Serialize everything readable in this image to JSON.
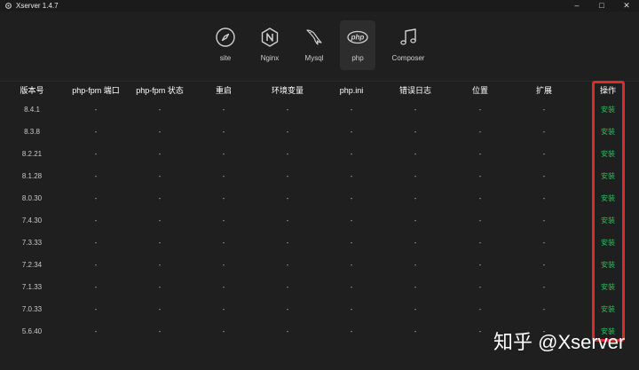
{
  "window": {
    "title": "Xserver 1.4.7",
    "controls": [
      "–",
      "□",
      "✕"
    ]
  },
  "toolbar": {
    "items": [
      {
        "key": "site",
        "label": "site",
        "icon": "compass-icon",
        "active": false
      },
      {
        "key": "nginx",
        "label": "Nginx",
        "icon": "nginx-hexagon-icon",
        "active": false
      },
      {
        "key": "mysql",
        "label": "Mysql",
        "icon": "dolphin-icon",
        "active": false
      },
      {
        "key": "php",
        "label": "php",
        "icon": "php-logo-icon",
        "active": true
      },
      {
        "key": "composer",
        "label": "Composer",
        "icon": "music-note-icon",
        "active": false
      }
    ]
  },
  "table": {
    "headers": [
      "版本号",
      "php-fpm 端口",
      "php-fpm 状态",
      "重启",
      "环境变量",
      "php.ini",
      "错误日志",
      "位置",
      "扩展",
      "操作"
    ],
    "rows": [
      {
        "version": "8.4.1",
        "port": "-",
        "status": "-",
        "restart": "-",
        "env": "-",
        "ini": "-",
        "log": "-",
        "location": "-",
        "ext": "-",
        "action": "安装"
      },
      {
        "version": "8.3.8",
        "port": "-",
        "status": "-",
        "restart": "-",
        "env": "-",
        "ini": "-",
        "log": "-",
        "location": "-",
        "ext": "-",
        "action": "安装"
      },
      {
        "version": "8.2.21",
        "port": "-",
        "status": "-",
        "restart": "-",
        "env": "-",
        "ini": "-",
        "log": "-",
        "location": "-",
        "ext": "-",
        "action": "安装"
      },
      {
        "version": "8.1.28",
        "port": "-",
        "status": "-",
        "restart": "-",
        "env": "-",
        "ini": "-",
        "log": "-",
        "location": "-",
        "ext": "-",
        "action": "安装"
      },
      {
        "version": "8.0.30",
        "port": "-",
        "status": "-",
        "restart": "-",
        "env": "-",
        "ini": "-",
        "log": "-",
        "location": "-",
        "ext": "-",
        "action": "安装"
      },
      {
        "version": "7.4.30",
        "port": "-",
        "status": "-",
        "restart": "-",
        "env": "-",
        "ini": "-",
        "log": "-",
        "location": "-",
        "ext": "-",
        "action": "安装"
      },
      {
        "version": "7.3.33",
        "port": "-",
        "status": "-",
        "restart": "-",
        "env": "-",
        "ini": "-",
        "log": "-",
        "location": "-",
        "ext": "-",
        "action": "安装"
      },
      {
        "version": "7.2.34",
        "port": "-",
        "status": "-",
        "restart": "-",
        "env": "-",
        "ini": "-",
        "log": "-",
        "location": "-",
        "ext": "-",
        "action": "安装"
      },
      {
        "version": "7.1.33",
        "port": "-",
        "status": "-",
        "restart": "-",
        "env": "-",
        "ini": "-",
        "log": "-",
        "location": "-",
        "ext": "-",
        "action": "安装"
      },
      {
        "version": "7.0.33",
        "port": "-",
        "status": "-",
        "restart": "-",
        "env": "-",
        "ini": "-",
        "log": "-",
        "location": "-",
        "ext": "-",
        "action": "安装"
      },
      {
        "version": "5.6.40",
        "port": "-",
        "status": "-",
        "restart": "-",
        "env": "-",
        "ini": "-",
        "log": "-",
        "location": "-",
        "ext": "-",
        "action": "安装"
      }
    ]
  },
  "watermark": "知乎 @Xserver",
  "colors": {
    "background": "#1f1f1f",
    "action_green": "#27c05a",
    "highlight_red": "#e02a2a"
  }
}
